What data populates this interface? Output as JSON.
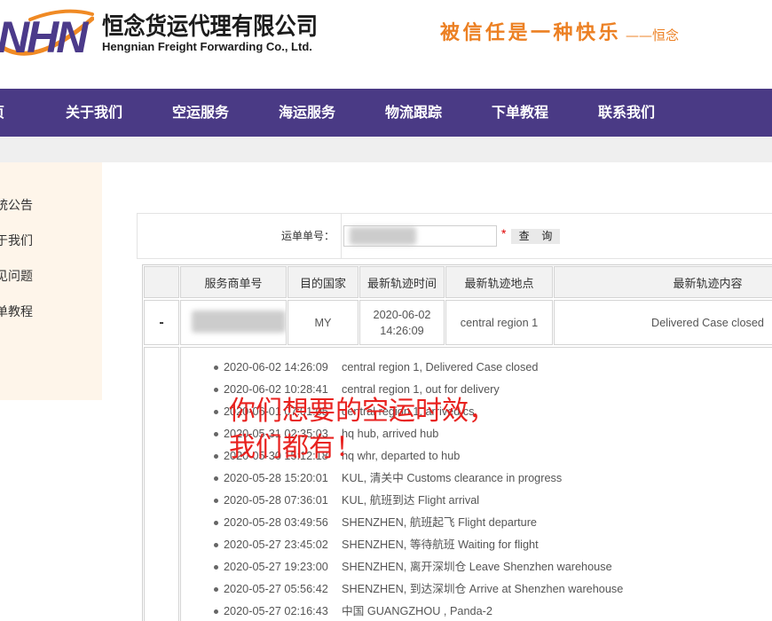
{
  "header": {
    "logo": {
      "lettering": "NHN",
      "primary_color": "#4b3a8a",
      "accent_color": "#f08a24"
    },
    "company_cn": "恒念货运代理有限公司",
    "company_en": "Hengnian Freight Forwarding Co., Ltd.",
    "slogan": "被信任是一种快乐",
    "slogan_sign": "——恒念"
  },
  "nav": {
    "items": [
      {
        "label": "页"
      },
      {
        "label": "关于我们"
      },
      {
        "label": "空运服务"
      },
      {
        "label": "海运服务"
      },
      {
        "label": "物流跟踪"
      },
      {
        "label": "下单教程"
      },
      {
        "label": "联系我们"
      }
    ]
  },
  "sidebar": {
    "items": [
      {
        "label": "统公告"
      },
      {
        "label": "于我们"
      },
      {
        "label": "见问题"
      },
      {
        "label": "单教程"
      }
    ]
  },
  "search": {
    "label": "运单单号：",
    "required_mark": "*",
    "button_label": "查 询"
  },
  "table": {
    "columns": [
      "服务商单号",
      "目的国家",
      "最新轨迹时间",
      "最新轨迹地点",
      "最新轨迹内容"
    ],
    "rows": [
      {
        "toggle": "-",
        "country": "MY",
        "latest_date": "2020-06-02",
        "latest_time": "14:26:09",
        "latest_location": "central region 1",
        "latest_content": "Delivered Case closed",
        "events": [
          {
            "time": "2020-06-02 14:26:09",
            "desc": "central region 1, Delivered Case closed"
          },
          {
            "time": "2020-06-02 10:28:41",
            "desc": "central region 1, out for delivery"
          },
          {
            "time": "2020-06-01 07:01:05",
            "desc": "central region 1, arrived cs"
          },
          {
            "time": "2020-05-31 02:35:03",
            "desc": "hq hub, arrived hub"
          },
          {
            "time": "2020-05-30 15:12:18",
            "desc": "hq whr, departed to hub"
          },
          {
            "time": "2020-05-28 15:20:01",
            "desc": "KUL, 清关中 Customs clearance in progress"
          },
          {
            "time": "2020-05-28 07:36:01",
            "desc": "KUL, 航班到达 Flight arrival"
          },
          {
            "time": "2020-05-28 03:49:56",
            "desc": "SHENZHEN, 航班起飞 Flight departure"
          },
          {
            "time": "2020-05-27 23:45:02",
            "desc": "SHENZHEN, 等待航班 Waiting for flight"
          },
          {
            "time": "2020-05-27 19:23:00",
            "desc": "SHENZHEN, 离开深圳仓 Leave Shenzhen warehouse"
          },
          {
            "time": "2020-05-27 05:56:42",
            "desc": "SHENZHEN, 到达深圳仓 Arrive at Shenzhen warehouse"
          },
          {
            "time": "2020-05-27 02:16:43",
            "desc": "中国 GUANGZHOU , Panda-2"
          }
        ]
      }
    ]
  },
  "overlay": {
    "line1": "你们想要的空运时效，",
    "line2": "我们都有！"
  },
  "theme": {
    "nav_bg": "#4a3a85",
    "slogan_orange": "#ec8023",
    "overlay_red": "#e8221f",
    "required_red": "#e00000",
    "sidebar_bg": "#fef5ea",
    "band_bg": "#efefef"
  }
}
